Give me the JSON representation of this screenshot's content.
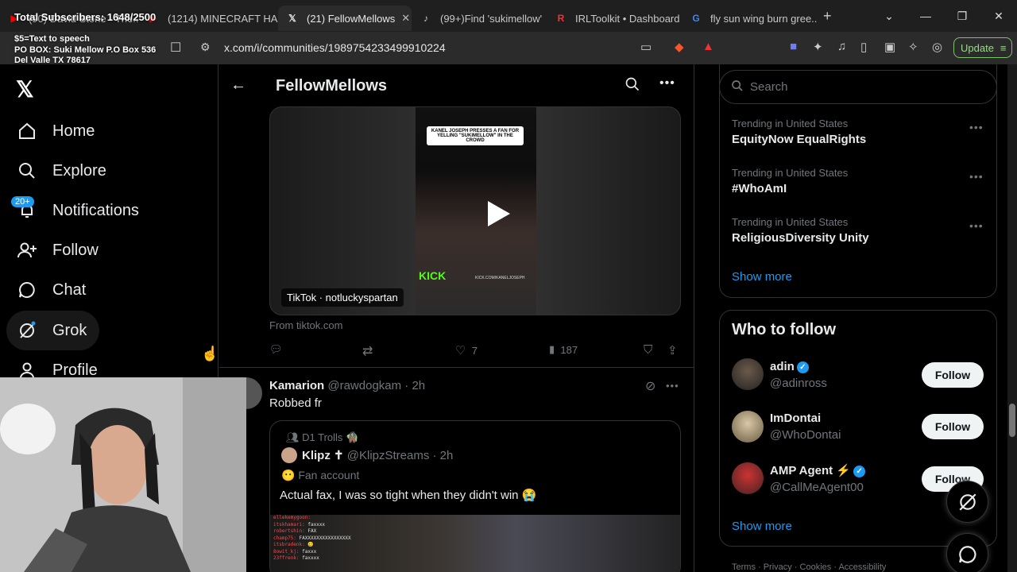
{
  "tabs": [
    {
      "title": "(90) David Stone - The...",
      "active": false
    },
    {
      "title": "(1214) MINECRAFT HA...",
      "active": false
    },
    {
      "title": "(21) FellowMellows",
      "active": true
    },
    {
      "title": "(99+)Find 'sukimellow'",
      "active": false
    },
    {
      "title": "IRLToolkit • Dashboard",
      "active": false
    },
    {
      "title": "fly sun wing burn gree...",
      "active": false
    }
  ],
  "address": {
    "url": "x.com/i/communities/1989754233499910224"
  },
  "overlay": {
    "subs": "Total Subscribers: 1648/2500",
    "tts_line1": "$5=Text to speech",
    "tts_line2": "PO BOX: Suki Mellow P.O Box 536",
    "tts_line3": "Del Valle TX 78617"
  },
  "browser": {
    "update_label": "Update"
  },
  "nav": {
    "home": "Home",
    "explore": "Explore",
    "notifications": "Notifications",
    "notif_badge": "20+",
    "follow": "Follow",
    "chat": "Chat",
    "grok": "Grok",
    "profile": "Profile"
  },
  "community": {
    "title": "FellowMellows"
  },
  "post1": {
    "video_caption": "KANEL JOSEPH PRESSES A FAN FOR YELLING \"SUKIMELLOW\" IN THE CROWD",
    "kick": "KICK",
    "kick_url": "KICK.COM/KANELJOSEPH",
    "video_label": "TikTok · notluckyspartan",
    "from": "From tiktok.com",
    "likes": "7",
    "views": "187"
  },
  "post2": {
    "name": "Kamarion",
    "handle": "@rawdogkam · 2h",
    "text": "Robbed fr",
    "quote": {
      "community": "D1 Trolls 🧌",
      "name": "Klipz ✝",
      "handle": "@KlipzStreams · 2h",
      "sub": "Fan account",
      "text": "Actual fax, I was so tight when they didn't win 😭",
      "chat": [
        {
          "n": "ellekemygoon:",
          "m": ""
        },
        {
          "n": "itskhamari:",
          "m": "faxxxx"
        },
        {
          "n": "robertshin:",
          "m": "FAX"
        },
        {
          "n": "champ75:",
          "m": "FAXXXXXXXXXXXXXXXX"
        },
        {
          "n": "itsbradenk:",
          "m": "🥲"
        },
        {
          "n": "8owit_kj:",
          "m": "faxxx"
        },
        {
          "n": "23ffrenk:",
          "m": "faxxxx"
        }
      ]
    }
  },
  "search": {
    "placeholder": "Search"
  },
  "trends": [
    {
      "meta": "Trending in United States",
      "title": "EquityNow EqualRights"
    },
    {
      "meta": "Trending in United States",
      "title": "#WhoAmI"
    },
    {
      "meta": "Trending in United States",
      "title": "ReligiousDiversity Unity"
    }
  ],
  "trends_show_more": "Show more",
  "who_to_follow": {
    "title": "Who to follow",
    "show_more": "Show more",
    "users": [
      {
        "name": "adin",
        "handle": "@adinross",
        "button": "Follow"
      },
      {
        "name": "ImDontai",
        "handle": "@WhoDontai",
        "button": "Follow"
      },
      {
        "name": "AMP Agent ⚡",
        "handle": "@CallMeAgent00",
        "button": "Follow"
      }
    ]
  },
  "footer": {
    "links": "Terms  ·  Privacy  ·  Cookies  ·  Accessibility"
  },
  "colors": {
    "accent": "#1d9bf0",
    "bg": "#000000",
    "border": "#2f3336",
    "muted": "#71767b"
  }
}
